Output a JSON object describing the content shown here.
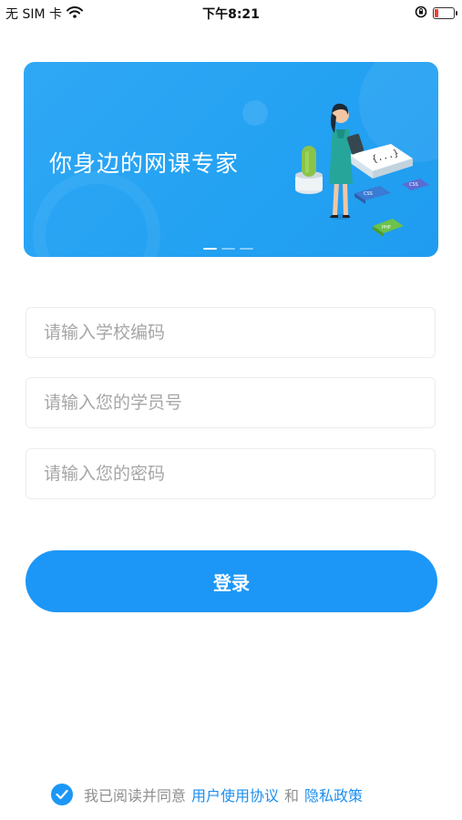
{
  "status_bar": {
    "carrier": "无 SIM 卡",
    "time": "下午8:21",
    "icons": [
      "wifi-icon",
      "rotation-lock-icon",
      "battery-low-icon"
    ]
  },
  "banner": {
    "title": "你身边的网课专家",
    "illustration": "teacher-with-tablet-and-books",
    "book_labels": [
      "{...}",
      "CSS",
      "CSS",
      "PHP"
    ],
    "pager_count": 3,
    "pager_active": 0,
    "background_color": "#23a1f2"
  },
  "form": {
    "school_code_placeholder": "请输入学校编码",
    "student_id_placeholder": "请输入您的学员号",
    "password_placeholder": "请输入您的密码"
  },
  "login": {
    "label": "登录",
    "color": "#1c97f7"
  },
  "agreement": {
    "checked": true,
    "prefix": "我已阅读并同意",
    "terms_link": "用户使用协议",
    "conjunction": "和",
    "privacy_link": "隐私政策",
    "link_color": "#1c8ff0"
  }
}
